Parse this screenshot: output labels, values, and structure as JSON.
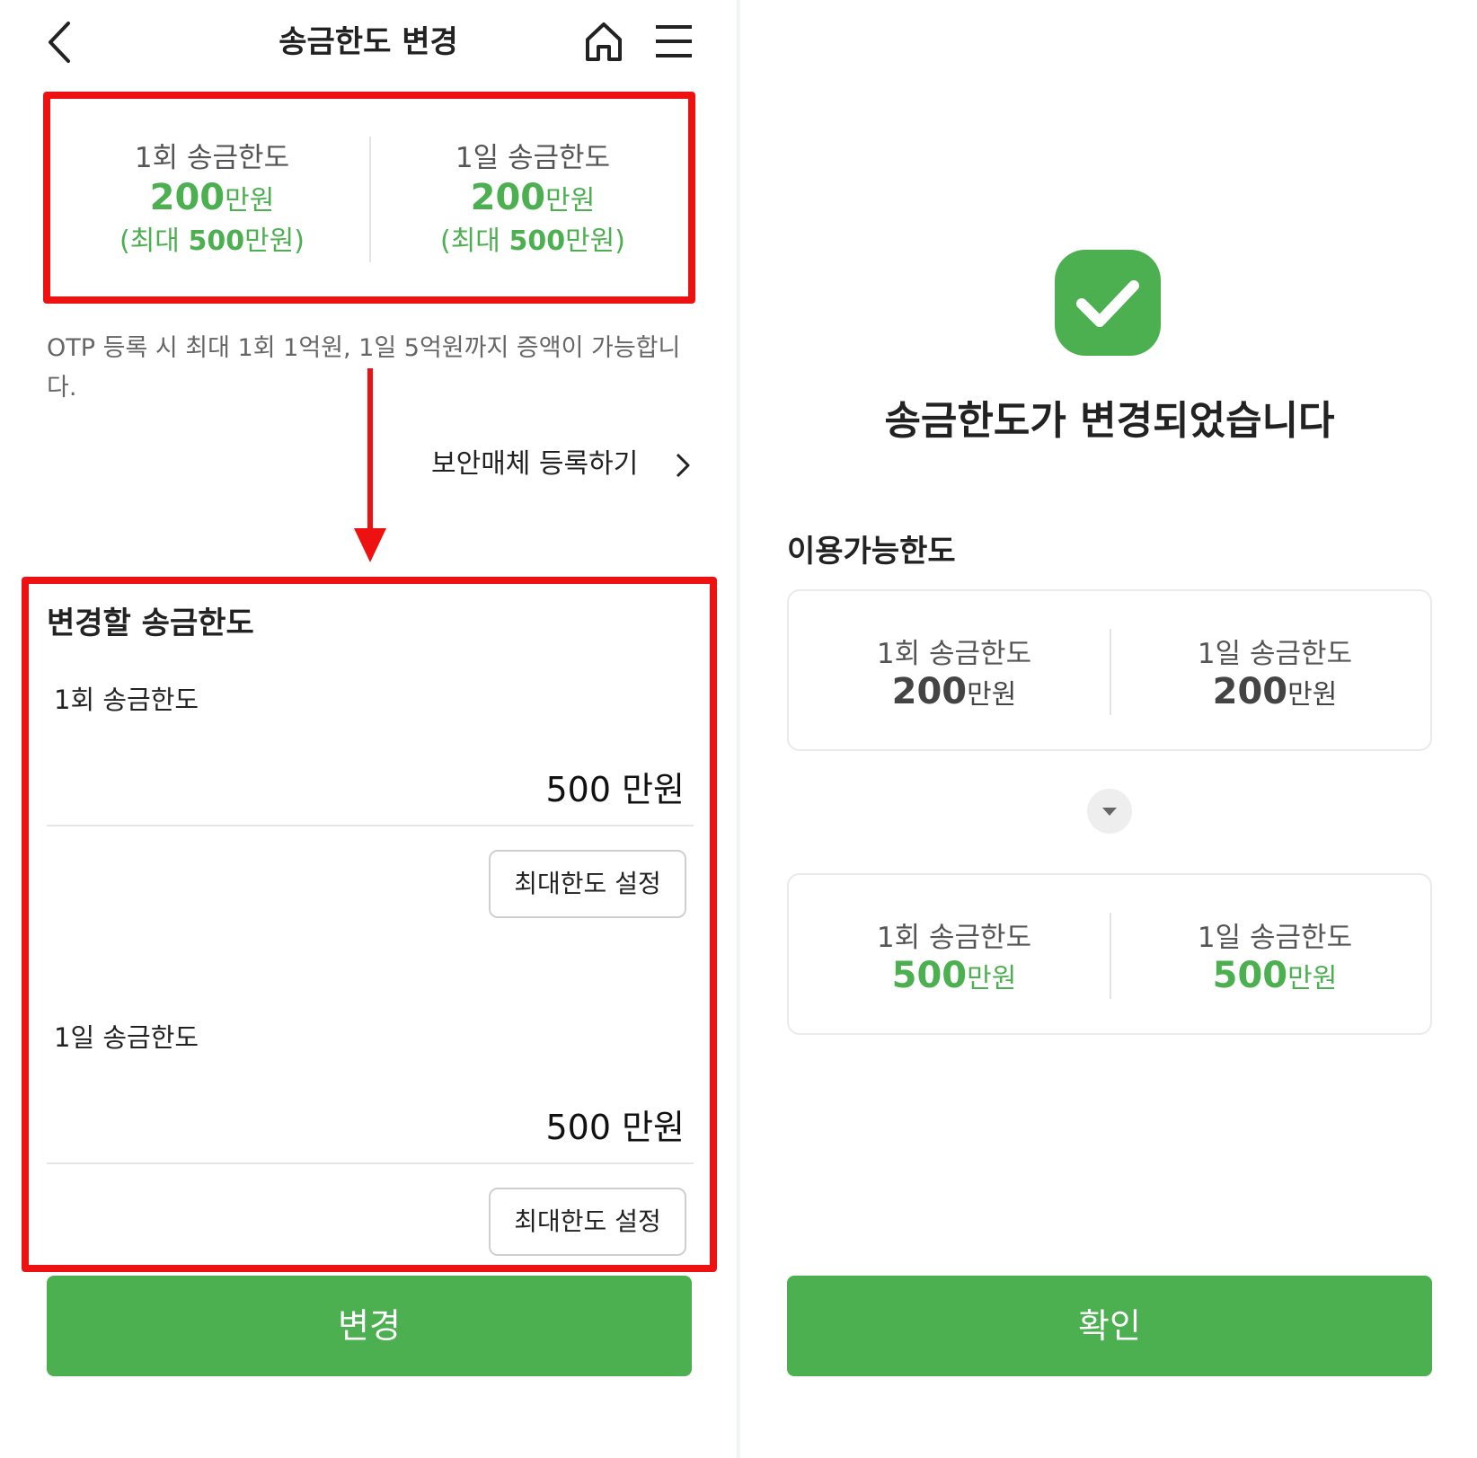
{
  "left": {
    "header": {
      "title": "송금한도 변경",
      "back_icon": "chevron-left-icon",
      "home_icon": "home-icon",
      "menu_icon": "hamburger-icon"
    },
    "current_limits": {
      "per_transfer": {
        "label": "1회 송금한도",
        "amount": "200",
        "unit": "만원",
        "max_open": "(최대 ",
        "max_amount": "500",
        "max_close": "만원)"
      },
      "per_day": {
        "label": "1일 송금한도",
        "amount": "200",
        "unit": "만원",
        "max_open": "(최대 ",
        "max_amount": "500",
        "max_close": "만원)"
      }
    },
    "otp_notice": "OTP 등록 시 최대 1회 1억원, 1일 5억원까지 증액이 가능합니다.",
    "security_link": "보안매체 등록하기",
    "change_section": {
      "title": "변경할 송금한도",
      "per_transfer": {
        "label": "1회 송금한도",
        "value": "500 만원",
        "max_button": "최대한도 설정"
      },
      "per_day": {
        "label": "1일 송금한도",
        "value": "500 만원",
        "max_button": "최대한도 설정"
      }
    },
    "submit_button": "변경"
  },
  "right": {
    "success_icon": "check-icon",
    "success_message": "송금한도가 변경되었습니다",
    "available_title": "이용가능한도",
    "before": {
      "per_transfer": {
        "label": "1회 송금한도",
        "amount": "200",
        "unit": "만원"
      },
      "per_day": {
        "label": "1일 송금한도",
        "amount": "200",
        "unit": "만원"
      }
    },
    "arrow_icon": "caret-down-icon",
    "after": {
      "per_transfer": {
        "label": "1회 송금한도",
        "amount": "500",
        "unit": "만원"
      },
      "per_day": {
        "label": "1일 송금한도",
        "amount": "500",
        "unit": "만원"
      }
    },
    "confirm_button": "확인"
  },
  "colors": {
    "accent_green": "#4caf50",
    "annotation_red": "#ee1111"
  }
}
